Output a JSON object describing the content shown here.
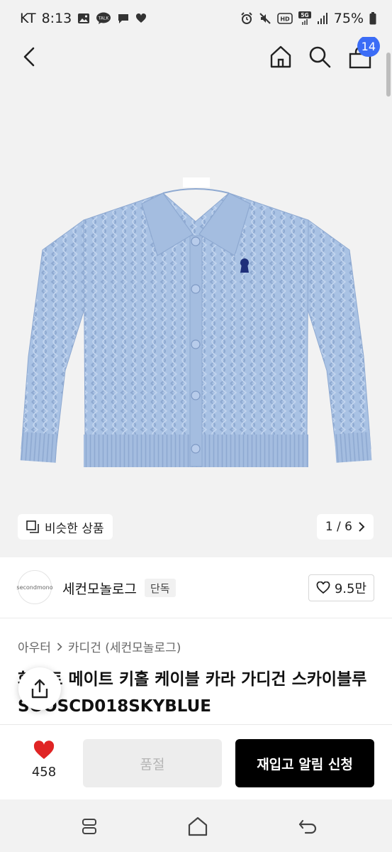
{
  "status_bar": {
    "carrier": "KT",
    "time": "8:13",
    "talk_label": "TALK",
    "hd_label": "HD",
    "network_label": "5G",
    "battery": "75%"
  },
  "nav": {
    "cart_count": "14"
  },
  "gallery": {
    "similar_label": "비슷한 상품",
    "pager": "1 / 6"
  },
  "brand": {
    "avatar_text": "secondmono",
    "name": "세컨모놀로그",
    "exclusive_label": "단독",
    "likes": "9.5만"
  },
  "product": {
    "category_main": "아우터",
    "category_sub": "카디건 (세컨모놀로그)",
    "title": "화이트 메이트 키홀 케이블 카라 가디건 스카이블루 SOOSCD018SKYBLUE"
  },
  "actions": {
    "fav_count": "458",
    "soldout_label": "품절",
    "notify_label": "재입고 알림 신청"
  },
  "colors": {
    "accent": "#3b6cf6",
    "heart": "#e02424",
    "cardigan": "#a9c2e4"
  }
}
